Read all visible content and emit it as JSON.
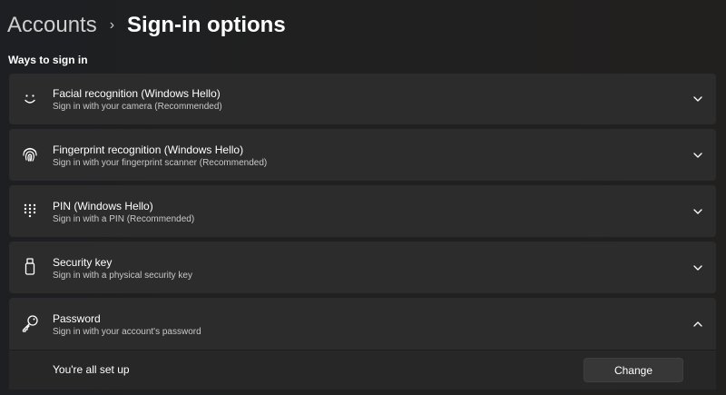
{
  "breadcrumb": {
    "parent": "Accounts",
    "separator": "›",
    "current": "Sign-in options"
  },
  "section_title": "Ways to sign in",
  "options": [
    {
      "icon": "smile-face-icon",
      "title": "Facial recognition (Windows Hello)",
      "subtitle": "Sign in with your camera (Recommended)",
      "expanded": false
    },
    {
      "icon": "fingerprint-icon",
      "title": "Fingerprint recognition (Windows Hello)",
      "subtitle": "Sign in with your fingerprint scanner (Recommended)",
      "expanded": false
    },
    {
      "icon": "pin-keypad-icon",
      "title": "PIN (Windows Hello)",
      "subtitle": "Sign in with a PIN (Recommended)",
      "expanded": false
    },
    {
      "icon": "usb-key-icon",
      "title": "Security key",
      "subtitle": "Sign in with a physical security key",
      "expanded": false
    },
    {
      "icon": "key-icon",
      "title": "Password",
      "subtitle": "Sign in with your account's password",
      "expanded": true
    }
  ],
  "password_panel": {
    "status": "You're all set up",
    "change_label": "Change"
  },
  "colors": {
    "background": "#202020",
    "card": "#2c2c2c",
    "card_expanded_body": "#272727",
    "button": "#373737",
    "text": "#ffffff",
    "subtext": "#c8c8c8"
  }
}
